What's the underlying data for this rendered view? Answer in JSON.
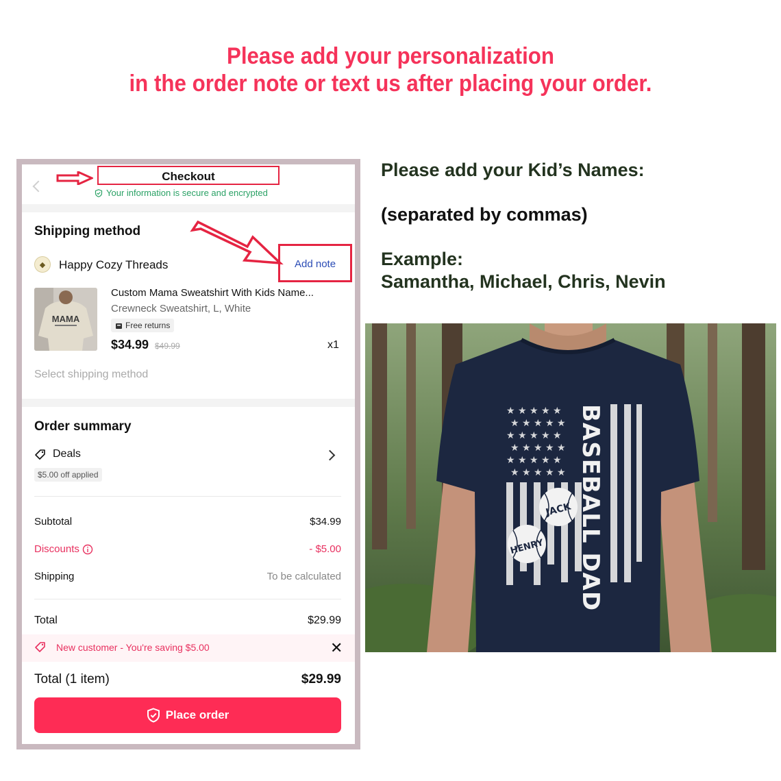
{
  "headline": {
    "line1": "Please add your personalization",
    "line2": "in the order note or text us after placing your order."
  },
  "checkout": {
    "title": "Checkout",
    "secure_note": "Your information is secure and encrypted",
    "shipping_section_title": "Shipping method",
    "shop_name": "Happy Cozy Threads",
    "add_note_label": "Add note",
    "product": {
      "title": "Custom Mama Sweatshirt With Kids Name...",
      "variant": "Crewneck Sweatshirt, L, White",
      "badge": "Free returns",
      "price": "$34.99",
      "original_price": "$49.99",
      "quantity": "x1",
      "thumb_text": "MAMA"
    },
    "select_shipping": "Select shipping method",
    "order_summary_title": "Order summary",
    "deals_label": "Deals",
    "deals_applied": "$5.00 off applied",
    "rows": {
      "subtotal_label": "Subtotal",
      "subtotal_value": "$34.99",
      "discounts_label": "Discounts",
      "discounts_value": "- $5.00",
      "shipping_label": "Shipping",
      "shipping_value": "To be calculated",
      "total_label": "Total",
      "total_value": "$29.99"
    },
    "banner_text": "New customer - You're saving $5.00",
    "footer_total_label": "Total (1 item)",
    "footer_total_value": "$29.99",
    "place_order_label": "Place order"
  },
  "instructions": {
    "line1": "Please add your Kid’s Names:",
    "line2": "(separated by commas)",
    "line3": "Example:",
    "line4": "Samantha, Michael, Chris, Nevin"
  },
  "shirt_graphic": {
    "title": "BASEBALL DAD",
    "name1": "JACK",
    "name2": "HENRY"
  },
  "colors": {
    "accent": "#fe2c55",
    "headline": "#f5335a",
    "annotation_red": "#e52442",
    "secure_green": "#2aa165",
    "link_blue": "#2a4bb5",
    "shirt_navy": "#1c2740"
  }
}
